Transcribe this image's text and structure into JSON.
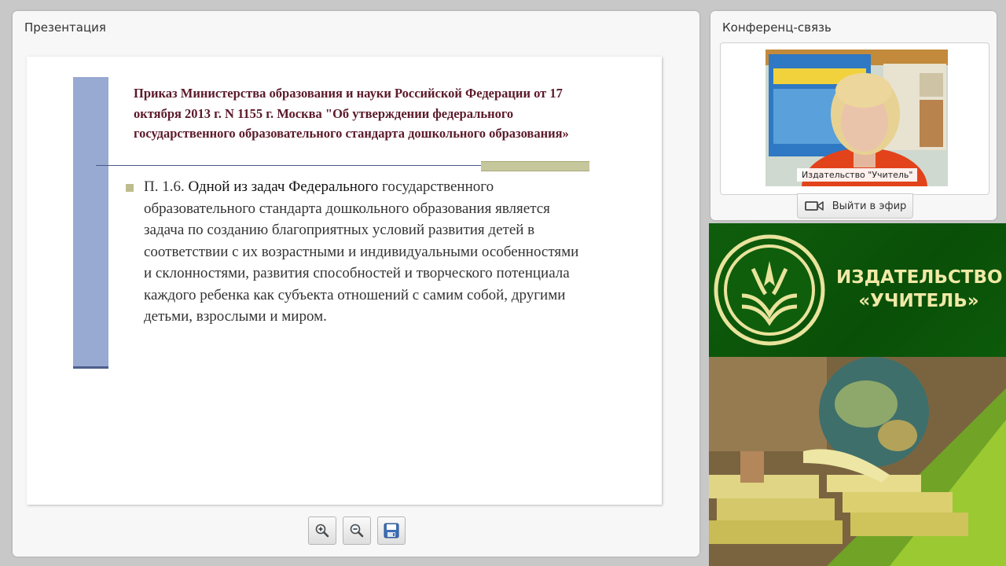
{
  "presentation": {
    "title": "Презентация",
    "slide": {
      "heading": "Приказ Министерства образования и науки Российской Федерации  от 17 октября 2013 г. N 1155 г. Москва \"Об утверждении федерального государственного образовательного стандарта дошкольного образования»",
      "body_prefix": "П. 1.6. ",
      "body_highlight": "Одной из задач  Федерального",
      "body_rest": " государственного образовательного стандарта дошкольного образования является задача по созданию благоприятных условий развития детей в соответствии с их возрастными и индивидуальными особенностями и склонностями, развития способностей и творческого потенциала каждого ребенка как субъекта отношений с самим собой, другими детьми, взрослыми и миром."
    },
    "toolbar": {
      "zoom_in_icon": "zoom-in-icon",
      "zoom_out_icon": "zoom-out-icon",
      "save_icon": "save-icon"
    }
  },
  "conference": {
    "title": "Конференц-связь",
    "video_caption": "Издательство \"Учитель\"",
    "onair_label": "Выйти в эфир",
    "onair_icon": "camera-icon"
  },
  "branding": {
    "name_line1": "ИЗДАТЕЛЬСТВО",
    "name_line2": "«УЧИТЕЛЬ»",
    "colors": {
      "green": "#0f5e0c",
      "gold": "#f0e9a6"
    }
  }
}
